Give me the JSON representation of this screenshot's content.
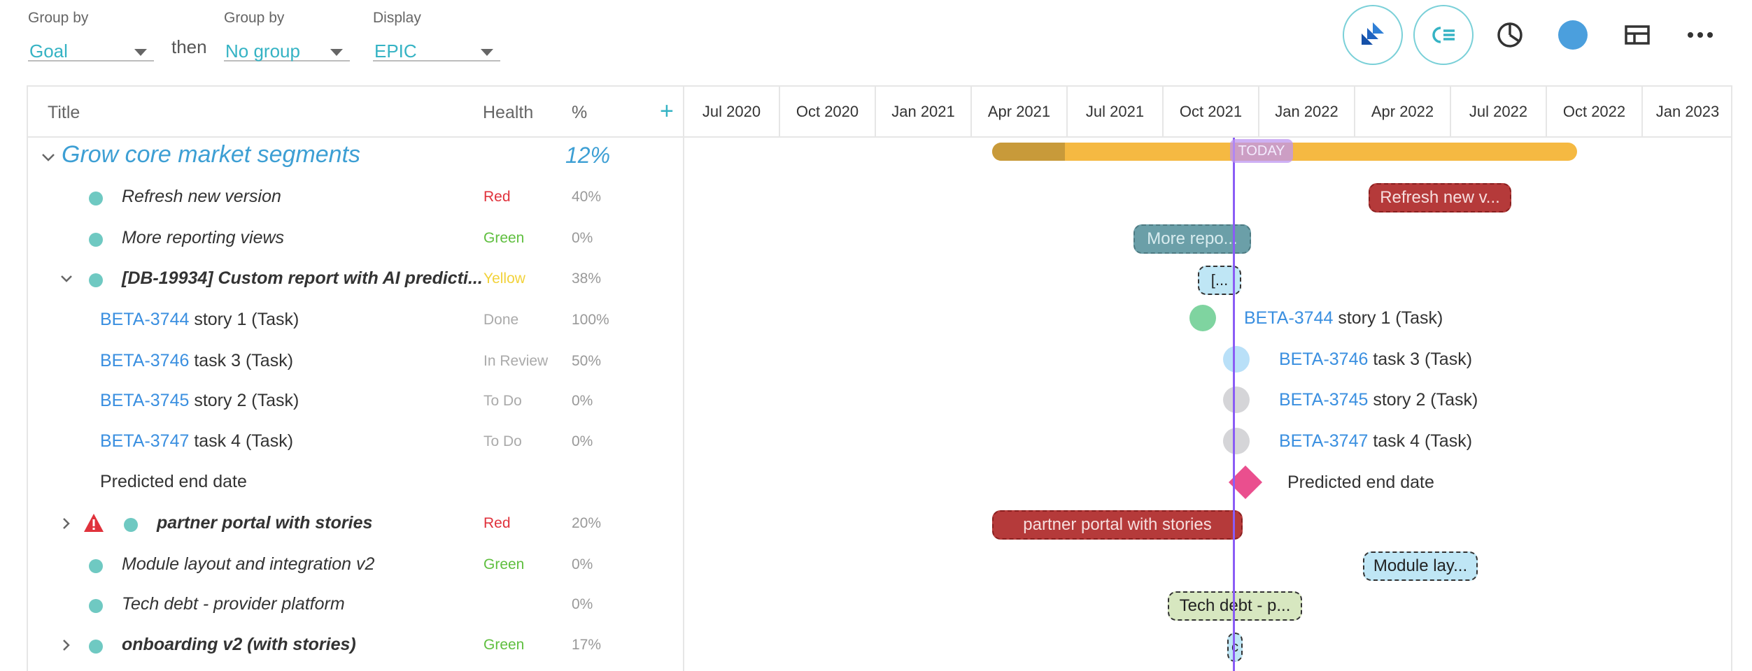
{
  "controls": {
    "group1": {
      "label": "Group by",
      "value": "Goal"
    },
    "then_text": "then",
    "group2": {
      "label": "Group by",
      "value": "No group"
    },
    "display": {
      "label": "Display",
      "value": "EPIC"
    }
  },
  "toolbar": {
    "icons": [
      "jira-icon",
      "collapse-list-icon",
      "pie-chart-icon",
      "color-dot-icon",
      "layout-icon",
      "more-icon"
    ],
    "accent": "#35b3c4"
  },
  "table": {
    "headers": {
      "title": "Title",
      "health": "Health",
      "pct": "%",
      "add": "+"
    },
    "months": [
      "Jul 2020",
      "Oct 2020",
      "Jan 2021",
      "Apr 2021",
      "Jul 2021",
      "Oct 2021",
      "Jan 2022",
      "Apr 2022",
      "Jul 2022",
      "Oct 2022",
      "Jan 2023"
    ],
    "goal": {
      "title": "Grow core market segments",
      "pct": "12%",
      "progress": 0.12
    },
    "rows": [
      {
        "title": "Refresh new version",
        "health": "Red",
        "health_color": "#e0323c",
        "pct": "40%"
      },
      {
        "title": "More reporting views",
        "health": "Green",
        "health_color": "#5fbf3f",
        "pct": "0%"
      },
      {
        "title": "[DB-19934] Custom report with AI predicti...",
        "health": "Yellow",
        "health_color": "#f2d23a",
        "pct": "38%"
      },
      {
        "key": "BETA-3744",
        "title": " story 1 (Task)",
        "health": "Done",
        "health_color": "#aaaaaa",
        "pct": "100%"
      },
      {
        "key": "BETA-3746",
        "title": " task 3 (Task)",
        "health": "In Review",
        "health_color": "#aaaaaa",
        "pct": "50%"
      },
      {
        "key": "BETA-3745",
        "title": " story 2 (Task)",
        "health": "To Do",
        "health_color": "#aaaaaa",
        "pct": "0%"
      },
      {
        "key": "BETA-3747",
        "title": " task 4 (Task)",
        "health": "To Do",
        "health_color": "#aaaaaa",
        "pct": "0%"
      },
      {
        "title": "Predicted end date",
        "health": "",
        "pct": ""
      },
      {
        "title": "partner portal with stories",
        "health": "Red",
        "health_color": "#e0323c",
        "pct": "20%"
      },
      {
        "title": "Module layout and integration v2",
        "health": "Green",
        "health_color": "#5fbf3f",
        "pct": "0%"
      },
      {
        "title": "Tech debt - provider platform",
        "health": "",
        "pct": "0%"
      },
      {
        "title": "onboarding v2 (with stories)",
        "health": "Green",
        "health_color": "#5fbf3f",
        "pct": "17%"
      }
    ]
  },
  "gantt": {
    "today_label": "TODAY",
    "pills": {
      "refresh": "Refresh new v...",
      "more": "More repo...",
      "custom": "[...",
      "partner": "partner portal with stories",
      "module": "Module lay...",
      "tech": "Tech debt - p...",
      "onboarding": "c"
    },
    "tasks": [
      {
        "key": "BETA-3744",
        "text": " story 1 (Task)",
        "color": "#7fd4a0"
      },
      {
        "key": "BETA-3746",
        "text": " task 3 (Task)",
        "color": "#b9e0f8"
      },
      {
        "key": "BETA-3745",
        "text": " story 2 (Task)",
        "color": "#d5d5d8"
      },
      {
        "key": "BETA-3747",
        "text": " task 4 (Task)",
        "color": "#d5d5d8"
      }
    ],
    "predicted_label": "Predicted end date"
  }
}
